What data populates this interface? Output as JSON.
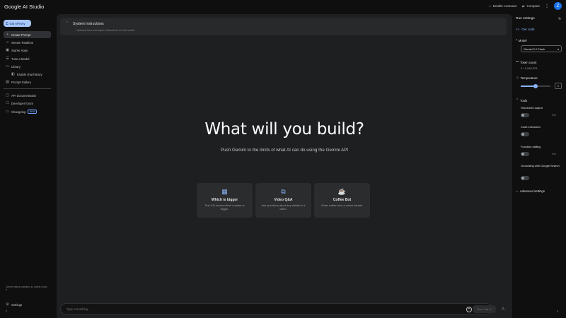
{
  "app": {
    "title": "Google AI Studio"
  },
  "topbar": {
    "autosave": "Enable Autosave",
    "compare": "Compare",
    "avatar_letter": "Z"
  },
  "sidebar": {
    "api_key": "Get API key",
    "items": [
      {
        "label": "Create Prompt",
        "icon": "plus-icon"
      },
      {
        "label": "Stream Realtime",
        "icon": "stream-icon"
      },
      {
        "label": "Starter Apps",
        "icon": "apps-icon"
      },
      {
        "label": "Tune a Model",
        "icon": "tune-icon"
      },
      {
        "label": "Library",
        "icon": "library-icon"
      },
      {
        "label": "Enable chat history",
        "icon": "toggle-icon"
      },
      {
        "label": "Prompt Gallery",
        "icon": "gallery-icon"
      },
      {
        "label": "API documentation",
        "icon": "code-icon"
      },
      {
        "label": "Developer forum",
        "icon": "forum-icon"
      },
      {
        "label": "Changelog",
        "icon": "changelog-icon",
        "badge": "NEW"
      },
      {
        "label": "Settings",
        "icon": "gear-icon"
      }
    ],
    "note": "Gemini makes mistakes, so double-check it"
  },
  "main": {
    "system_instructions": {
      "title": "System Instructions",
      "placeholder": "Optional tone and style instructions for the model"
    },
    "hero_title": "What will you build?",
    "hero_subtitle": "Push Gemini to the limits of what AI can do using the Gemini API",
    "cards": [
      {
        "title": "Which is bigger",
        "desc": "Test if AI knows which number is bigger.",
        "icon": "grid-icon"
      },
      {
        "title": "Video Q&A",
        "desc": "Ask questions about key details in a video.",
        "icon": "video-icon"
      },
      {
        "title": "Coffee Bot",
        "desc": "Order coffee from a virtual barista.",
        "icon": "coffee-icon"
      }
    ],
    "prompt_placeholder": "Type something",
    "run_label": "Run",
    "run_shortcut": "Ctrl ⏎"
  },
  "run_settings": {
    "title": "Run settings",
    "get_code": "Get code",
    "model_label": "Model",
    "model_value": "Gemini 2.0 Flash",
    "token_label": "Token count",
    "token_value": "0 / 1,048,576",
    "temperature_label": "Temperature",
    "temperature_value": "1",
    "temperature_fraction": 0.5,
    "tools_label": "Tools",
    "tools": [
      {
        "name": "Structured output",
        "edit": "Edit"
      },
      {
        "name": "Code execution",
        "edit": ""
      },
      {
        "name": "Function calling",
        "edit": "Edit"
      },
      {
        "name": "Grounding with Google Search",
        "edit": ""
      }
    ],
    "advanced": "Advanced settings"
  },
  "colors": {
    "accent": "#8ab4f8",
    "api_key_bg": "#a8c7fa",
    "avatar": "#1a73e8"
  }
}
